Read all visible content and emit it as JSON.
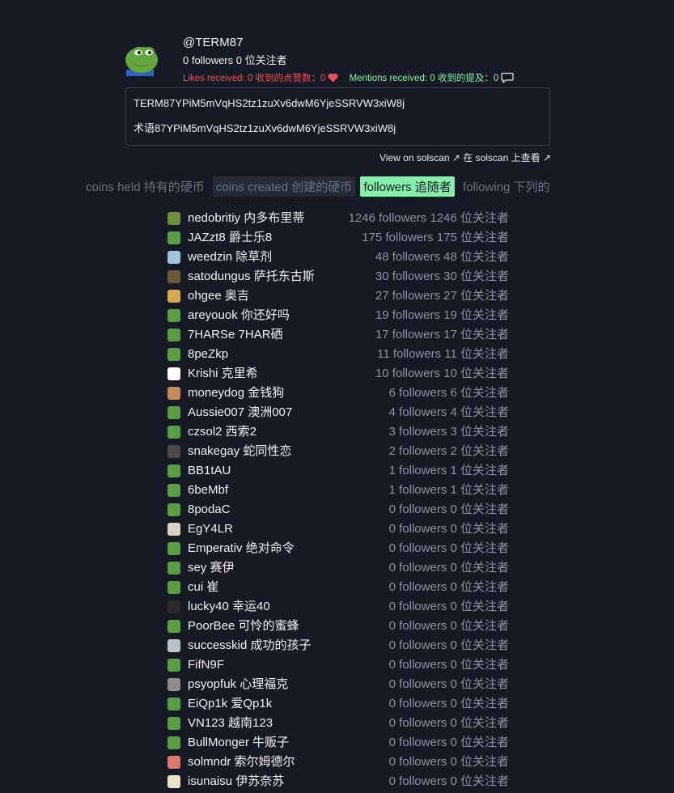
{
  "profile": {
    "handle": "@TERM87",
    "followers_text": "0 followers 0 位关注者",
    "likes_text": "Likes received: 0  收到的点赞数：0",
    "mentions_text": "Mentions received: 0  收到的提及：0",
    "address": "TERM87YPiM5mVqHS2tz1zuXv6dwM6YjeSSRVW3xiW8j",
    "address_translated": "术语87YPiM5mVqHS2tz1zuXv6dwM6YjeSSRVW3xiW8j",
    "solscan_link": "View on solscan ↗ 在 solscan 上查看 ↗"
  },
  "tabs": [
    {
      "label": "coins held 持有的硬币"
    },
    {
      "label": "coins created 创建的硬币"
    },
    {
      "label": "followers 追随者"
    },
    {
      "label": "following 下列的"
    }
  ],
  "active_tab": "followers 追随者",
  "colors": {
    "background": "#161a24",
    "likes": "#ef4f5a",
    "mentions": "#86efac",
    "active_tab": "#86efac",
    "muted": "#8b93a3"
  },
  "followers": [
    {
      "name": "nedobritiy  内多布里蒂",
      "count": "1246 followers 1246 位关注者"
    },
    {
      "name": "JAZzt8  爵士乐8",
      "count": "175 followers 175 位关注者"
    },
    {
      "name": "weedzin  除草剂",
      "count": "48 followers 48 位关注者"
    },
    {
      "name": "satodungus  萨托东古斯",
      "count": "30 followers 30 位关注者"
    },
    {
      "name": "ohgee  奥吉",
      "count": "27 followers 27 位关注者"
    },
    {
      "name": "areyouok  你还好吗",
      "count": "19 followers 19 位关注者"
    },
    {
      "name": "7HARSe  7HAR硒",
      "count": "17 followers 17 位关注者"
    },
    {
      "name": "8peZkp",
      "count": "11 followers 11 位关注者"
    },
    {
      "name": "Krishi  克里希",
      "count": "10 followers 10 位关注者"
    },
    {
      "name": "moneydog  金钱狗",
      "count": "6 followers 6 位关注者"
    },
    {
      "name": "Aussie007  澳洲007",
      "count": "4 followers 4 位关注者"
    },
    {
      "name": "czsol2  西索2",
      "count": "3 followers 3 位关注者"
    },
    {
      "name": "snakegay  蛇同性恋",
      "count": "2 followers 2 位关注者"
    },
    {
      "name": "BB1tAU",
      "count": "1 followers 1 位关注者"
    },
    {
      "name": "6beMbf",
      "count": "1 followers 1 位关注者"
    },
    {
      "name": "8podaC",
      "count": "0 followers 0 位关注者"
    },
    {
      "name": "EgY4LR",
      "count": "0 followers 0 位关注者"
    },
    {
      "name": "Emperativ  绝对命令",
      "count": "0 followers 0 位关注者"
    },
    {
      "name": "sey  赛伊",
      "count": "0 followers 0 位关注者"
    },
    {
      "name": "cui  崔",
      "count": "0 followers 0 位关注者"
    },
    {
      "name": "lucky40  幸运40",
      "count": "0 followers 0 位关注者"
    },
    {
      "name": "PoorBee  可怜的蜜蜂",
      "count": "0 followers 0 位关注者"
    },
    {
      "name": "successkid  成功的孩子",
      "count": "0 followers 0 位关注者"
    },
    {
      "name": "FifN9F",
      "count": "0 followers 0 位关注者"
    },
    {
      "name": "psyopfuk  心理福克",
      "count": "0 followers 0 位关注者"
    },
    {
      "name": "EiQp1k  爱Qp1k",
      "count": "0 followers 0 位关注者"
    },
    {
      "name": "VN123  越南123",
      "count": "0 followers 0 位关注者"
    },
    {
      "name": "BullMonger  牛贩子",
      "count": "0 followers 0 位关注者"
    },
    {
      "name": "solmndr  索尔姆德尔",
      "count": "0 followers 0 位关注者"
    },
    {
      "name": "isunaisu  伊苏奈苏",
      "count": "0 followers 0 位关注者"
    }
  ],
  "avatar_colors": [
    "#6b8f3a",
    "#5a9e42",
    "#9fc3e0",
    "#6a5a3a",
    "#d8a94b",
    "#5a9e42",
    "#5a9e42",
    "#5a9e42",
    "#ffffff",
    "#c98a5a",
    "#5a9e42",
    "#5a9e42",
    "#4a4a4a",
    "#5a9e42",
    "#5a9e42",
    "#5a9e42",
    "#d9d2c0",
    "#5a9e42",
    "#5a9e42",
    "#5a9e42",
    "#2a2a2a",
    "#5a9e42",
    "#b9c4c9",
    "#5a9e42",
    "#8d8d8d",
    "#5a9e42",
    "#5a9e42",
    "#5a9e42",
    "#d97a6a",
    "#e8e4c8"
  ]
}
